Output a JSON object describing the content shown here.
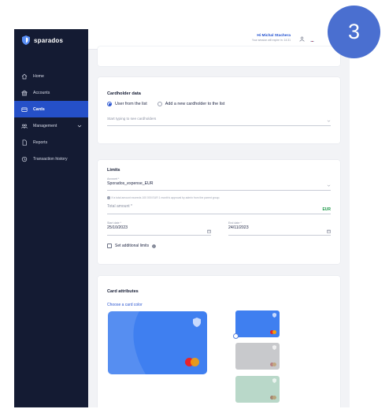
{
  "brand": {
    "name": "sparados"
  },
  "sidebar": {
    "items": [
      {
        "label": "Home",
        "icon": "home-icon",
        "active": false
      },
      {
        "label": "Accounts",
        "icon": "bank-icon",
        "active": false
      },
      {
        "label": "Cards",
        "icon": "card-icon",
        "active": true
      },
      {
        "label": "Management",
        "icon": "users-icon",
        "active": false
      },
      {
        "label": "Reports",
        "icon": "document-icon",
        "active": false
      },
      {
        "label": "Transaction history",
        "icon": "history-icon",
        "active": false
      }
    ]
  },
  "header": {
    "greeting": "Hi Michal Stachera",
    "session": "Your session will expire in: 14:31",
    "icons": [
      "user-icon",
      "flag-icon"
    ]
  },
  "cardholder": {
    "title": "Cardholder data",
    "option_list": "User from the list",
    "option_new": "Add a new cardholder to the list",
    "search_placeholder": "Start typing to see cardholders"
  },
  "limits": {
    "title": "Limits",
    "account_label": "Account *",
    "account_value": "Sporados_expense_EUR",
    "hint": "If a total amount exceeds 100 000 EUR 1 month's approval by admin from the parent group.",
    "total_placeholder": "Total amount *",
    "currency": "EUR",
    "start_label": "Start date *",
    "start_value": "25/10/2023",
    "end_label": "End date *",
    "end_value": "24/11/2023",
    "additional_limits": "Set additional limits"
  },
  "attributes": {
    "title": "Card attributes",
    "subtitle": "Choose a card color",
    "colors": [
      "#3f7ff0",
      "#c8c9cc",
      "#b9d8c9"
    ],
    "selected_index": 0
  },
  "step_badge": "3",
  "colors": {
    "sidebar": "#141b33",
    "accent": "#2550c8",
    "currency": "#1f9a4a",
    "badge": "#4a6fd0"
  }
}
